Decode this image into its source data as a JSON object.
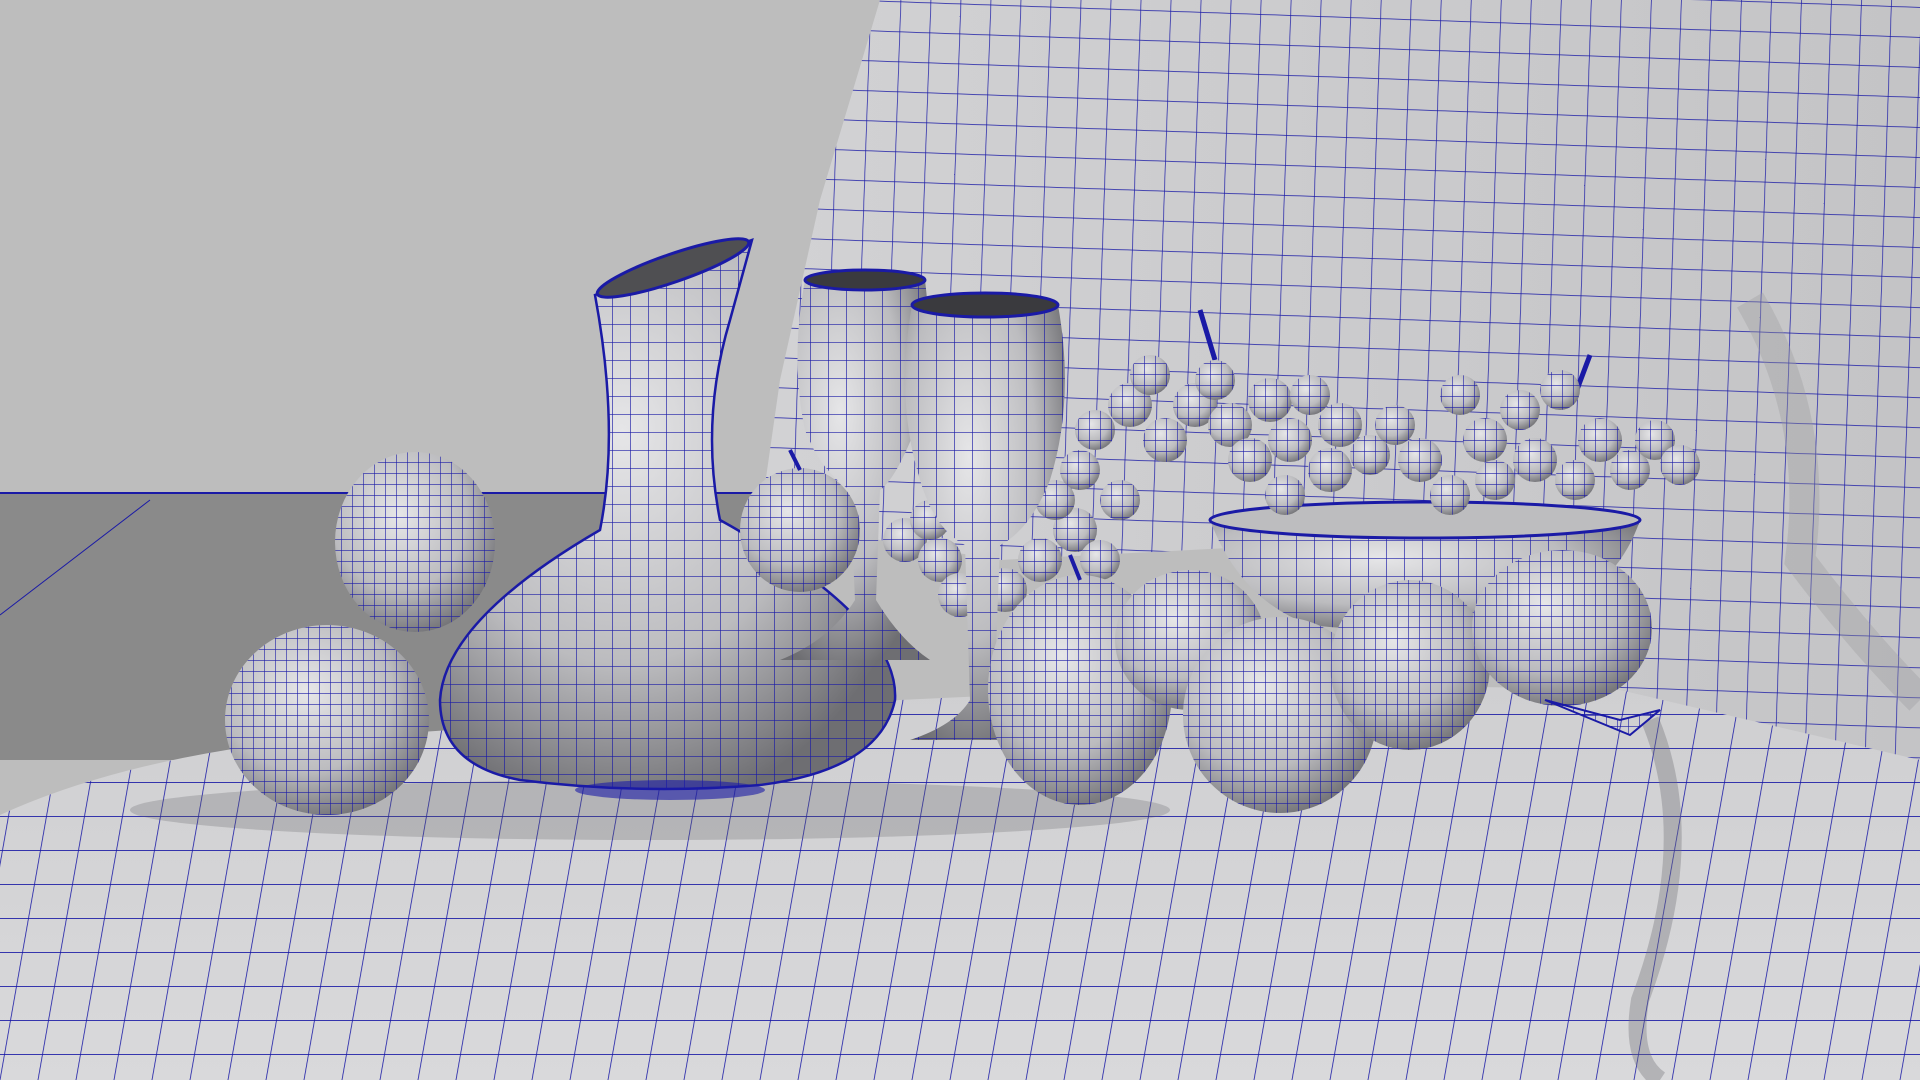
{
  "viewport": {
    "shading_mode": "wireframe-on-shaded",
    "background_color": "#bdbdbd",
    "floor_color": "#8a8a8a",
    "cloth_color": "#d4d4d6",
    "object_color": "#c9c9cb",
    "wire_color": "#1a1aa6",
    "shadow_color": "#4f4f52"
  },
  "scene": {
    "objects": [
      {
        "name": "draped-tablecloth",
        "type": "cloth"
      },
      {
        "name": "carafe",
        "type": "decanter"
      },
      {
        "name": "wine-glass-back",
        "type": "glass"
      },
      {
        "name": "wine-glass-front",
        "type": "glass"
      },
      {
        "name": "fruit-bowl",
        "type": "bowl"
      },
      {
        "name": "grapes-in-bowl",
        "type": "grape-cluster"
      },
      {
        "name": "grapes-on-table",
        "type": "grape-cluster"
      },
      {
        "name": "apple",
        "type": "apple",
        "count": 9
      }
    ]
  }
}
